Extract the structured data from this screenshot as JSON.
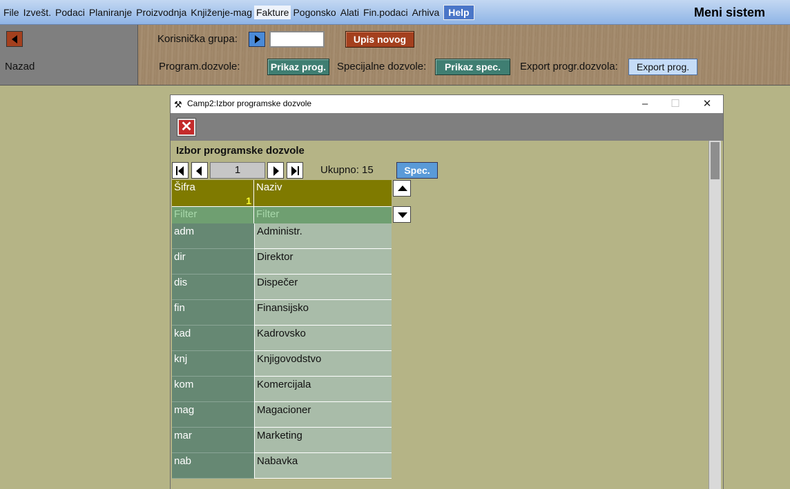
{
  "menubar": {
    "items": [
      "File",
      "Izvešt.",
      "Podaci",
      "Planiranje",
      "Proizvodnja",
      "Knjiženje-mag",
      "Fakture",
      "Pogonsko",
      "Alati",
      "Fin.podaci",
      "Arhiva"
    ],
    "active_item": "Fakture",
    "help_label": "Help",
    "brand": "Meni sistem"
  },
  "leftpanel": {
    "back_label": "Nazad"
  },
  "toolpanel": {
    "group_label": "Korisnička grupa:",
    "group_value": "",
    "new_button": "Upis novog",
    "program_label": "Program.dozvole:",
    "program_button": "Prikaz prog.",
    "special_label": "Specijalne dozvole:",
    "special_button": "Prikaz spec.",
    "export_label": "Export progr.dozvola:",
    "export_button": "Export prog."
  },
  "dialog": {
    "title": "Camp2:Izbor programske dozvole",
    "heading": "Izbor programske dozvole",
    "page": "1",
    "total": "Ukupno: 15",
    "spec_button": "Spec.",
    "columns": [
      {
        "header": "Šifra",
        "sort_index": "1",
        "filter_placeholder": "Filter"
      },
      {
        "header": "Naziv",
        "sort_index": "",
        "filter_placeholder": "Filter"
      }
    ],
    "rows": [
      {
        "code": "adm",
        "name": "Administr."
      },
      {
        "code": "dir",
        "name": "Direktor"
      },
      {
        "code": "dis",
        "name": "Dispečer"
      },
      {
        "code": "fin",
        "name": "Finansijsko"
      },
      {
        "code": "kad",
        "name": "Kadrovsko"
      },
      {
        "code": "knj",
        "name": "Knjigovodstvo"
      },
      {
        "code": "kom",
        "name": "Komercijala"
      },
      {
        "code": "mag",
        "name": "Magacioner"
      },
      {
        "code": "mar",
        "name": "Marketing"
      },
      {
        "code": "nab",
        "name": "Nabavka"
      }
    ]
  },
  "colors": {
    "desktop": "#b5b486",
    "header_olive": "#7f7a00",
    "button_green": "#3f7e72",
    "button_red": "#a4401e"
  }
}
